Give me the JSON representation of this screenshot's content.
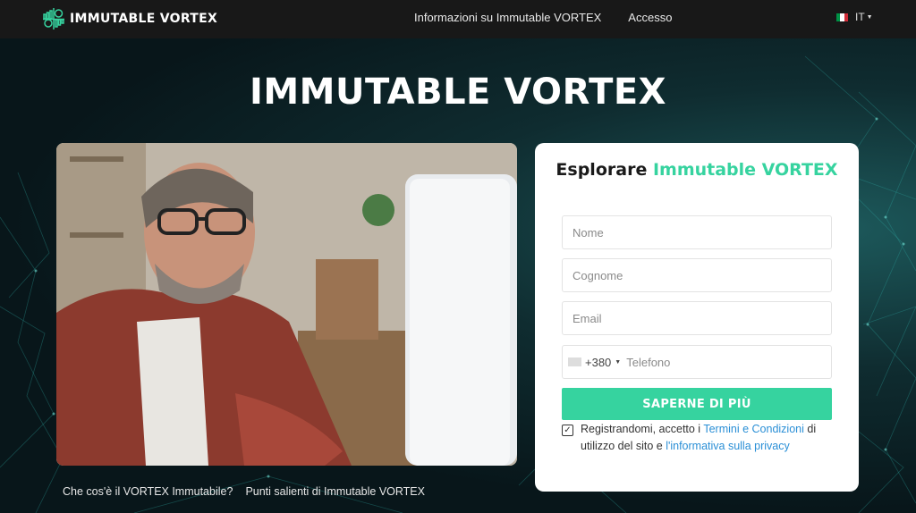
{
  "header": {
    "brand": "IMMUTABLE VORTEX",
    "nav": [
      "Informazioni su Immutable VORTEX",
      "Accesso"
    ],
    "language": "IT",
    "language_flag_colors": [
      "#009246",
      "#ffffff",
      "#ce2b37"
    ]
  },
  "hero": {
    "title": "IMMUTABLE VORTEX",
    "image_alt": "Man with glasses and plaid shirt smiling at a computer monitor"
  },
  "form": {
    "title_prefix": "Esplorare",
    "title_accent": "Immutable VORTEX",
    "fields": {
      "first_name_placeholder": "Nome",
      "last_name_placeholder": "Cognome",
      "email_placeholder": "Email",
      "phone_prefix": "+380",
      "phone_placeholder": "Telefono"
    },
    "submit_label": "SAPERNE DI PIÙ",
    "consent": {
      "checked": true,
      "text_1": "Registrandomi, accetto i ",
      "link_terms": "Termini e Condizioni",
      "text_2": " di utilizzo del sito e ",
      "link_privacy": "l'informativa sulla privacy"
    }
  },
  "footer_links": [
    "Che cos'è il VORTEX Immutabile?",
    "Punti salienti di Immutable VORTEX"
  ],
  "colors": {
    "accent": "#36d39f",
    "link": "#2a8fd6",
    "header_bg": "#181818"
  }
}
